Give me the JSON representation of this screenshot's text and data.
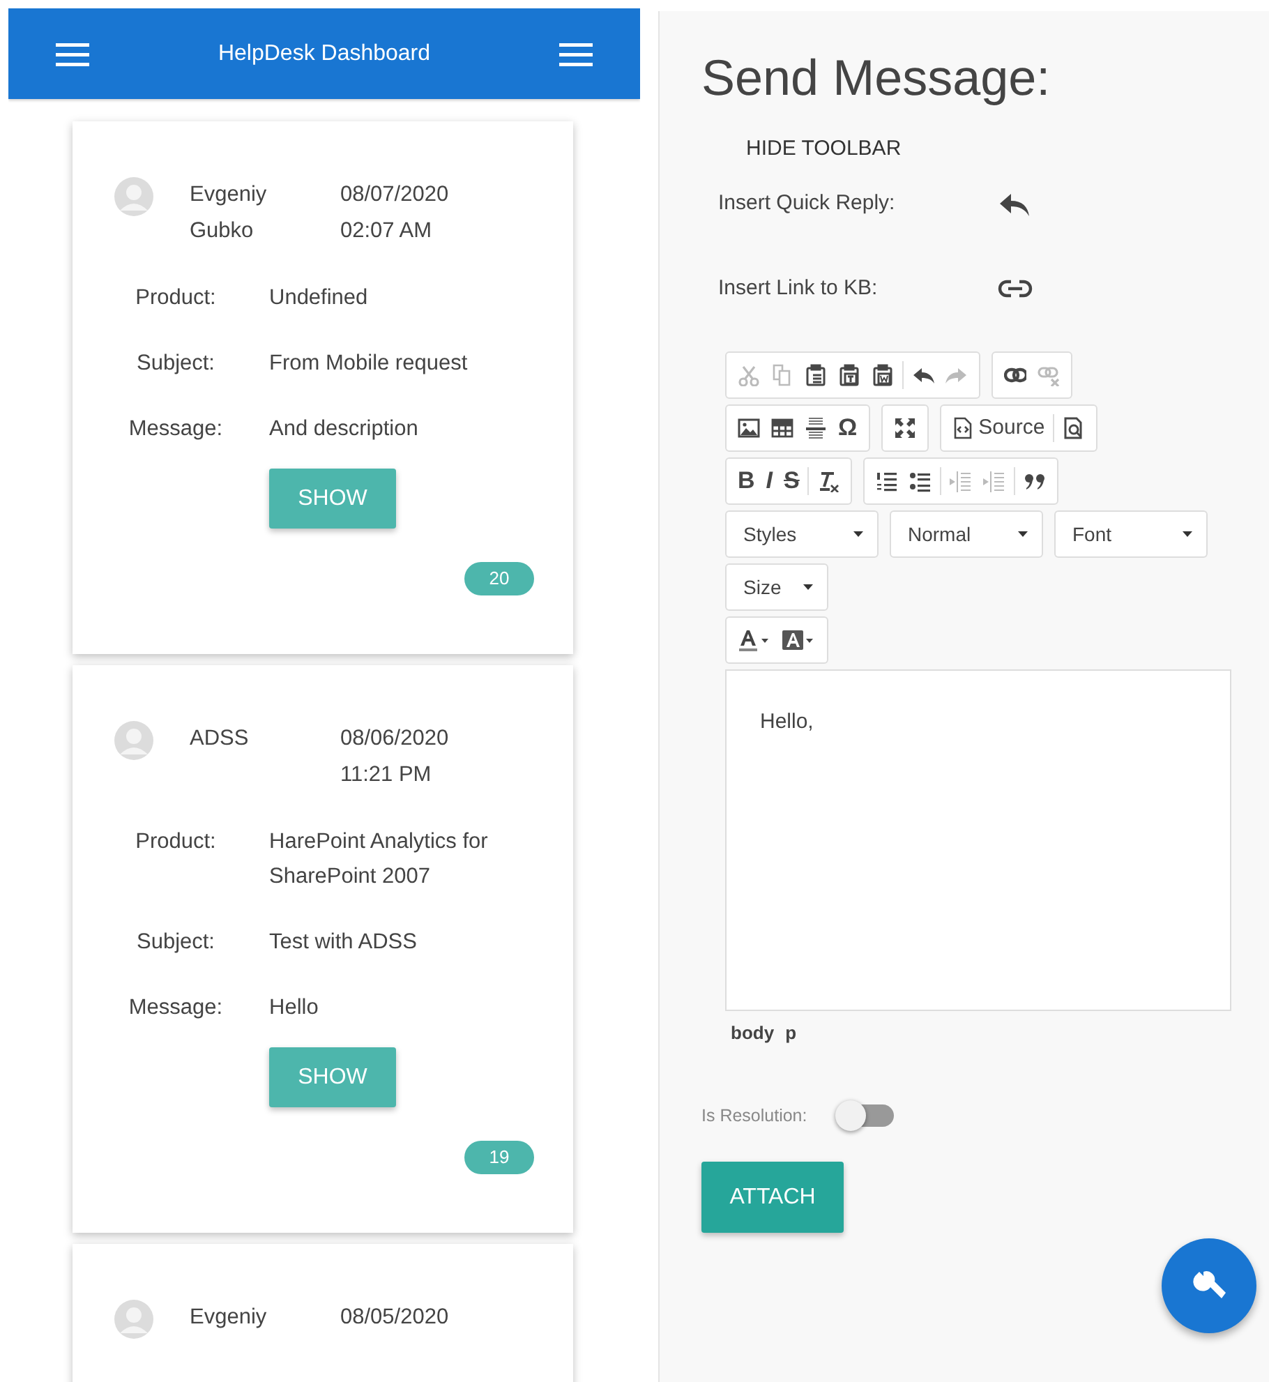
{
  "header": {
    "title": "HelpDesk Dashboard"
  },
  "tickets": [
    {
      "author": "Evgeniy Gubko",
      "date": "08/07/2020 02:07 AM",
      "fields": [
        {
          "label": "Product:",
          "value": "Undefined"
        },
        {
          "label": "Subject:",
          "value": "From Mobile request"
        },
        {
          "label": "Message:",
          "value": "And description"
        }
      ],
      "button": "SHOW",
      "count": "20"
    },
    {
      "author": "ADSS",
      "date": "08/06/2020 11:21 PM",
      "fields": [
        {
          "label": "Product:",
          "value": "HarePoint Analytics for SharePoint 2007"
        },
        {
          "label": "Subject:",
          "value": "Test with ADSS"
        },
        {
          "label": "Message:",
          "value": "Hello"
        }
      ],
      "button": "SHOW",
      "count": "19"
    },
    {
      "author": "Evgeniy",
      "date": "08/05/2020"
    }
  ],
  "composer": {
    "title": "Send Message:",
    "hide_toolbar": "HIDE TOOLBAR",
    "quick_reply_label": "Insert Quick Reply:",
    "kb_link_label": "Insert Link to KB:",
    "toolbar_rows": [
      [
        {
          "items": [
            {
              "kind": "icon",
              "disabled": true
            },
            {
              "kind": "icon",
              "disabled": true
            },
            {
              "kind": "icon",
              "disabled": false
            },
            {
              "kind": "icon",
              "disabled": false
            },
            {
              "kind": "icon",
              "disabled": false
            },
            {
              "kind": "separator"
            },
            {
              "kind": "icon",
              "disabled": false
            },
            {
              "kind": "icon",
              "disabled": true
            }
          ]
        },
        {
          "items": [
            {
              "kind": "icon",
              "disabled": false
            },
            {
              "kind": "icon",
              "disabled": true
            }
          ]
        }
      ],
      [
        {
          "items": [
            {
              "kind": "icon",
              "disabled": false
            },
            {
              "kind": "icon",
              "disabled": false
            },
            {
              "kind": "icon",
              "disabled": false
            },
            {
              "kind": "glyph",
              "glyph": "Ω",
              "disabled": false
            }
          ]
        },
        {
          "items": [
            {
              "kind": "icon",
              "disabled": false
            }
          ]
        },
        {
          "items": [
            {
              "kind": "labeled",
              "label": "Source",
              "disabled": false
            },
            {
              "kind": "separator"
            },
            {
              "kind": "icon",
              "disabled": false
            }
          ]
        }
      ],
      [
        {
          "items": [
            {
              "kind": "glyph",
              "glyph": "B",
              "disabled": false
            },
            {
              "kind": "glyph",
              "glyph": "I",
              "disabled": false
            },
            {
              "kind": "glyph",
              "glyph": "S",
              "disabled": false
            },
            {
              "kind": "separator"
            },
            {
              "kind": "icon",
              "disabled": false
            }
          ]
        },
        {
          "items": [
            {
              "kind": "icon",
              "disabled": false
            },
            {
              "kind": "icon",
              "disabled": false
            },
            {
              "kind": "separator"
            },
            {
              "kind": "icon",
              "disabled": true
            },
            {
              "kind": "icon",
              "disabled": true
            },
            {
              "kind": "separator"
            },
            {
              "kind": "icon",
              "disabled": false
            }
          ]
        }
      ]
    ],
    "combos": [
      [
        "Styles",
        "Normal",
        "Font"
      ],
      [
        "Size"
      ]
    ],
    "content": "Hello,",
    "path": [
      "body",
      "p"
    ],
    "resolution": {
      "label": "Is Resolution:",
      "on": false
    },
    "attach": "ATTACH"
  }
}
